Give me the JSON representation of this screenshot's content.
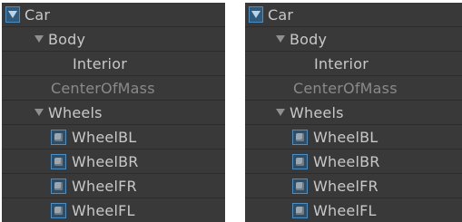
{
  "hierarchy_left": {
    "items": [
      {
        "label": "Car"
      },
      {
        "label": "Body"
      },
      {
        "label": "Interior"
      },
      {
        "label": "CenterOfMass"
      },
      {
        "label": "Wheels"
      },
      {
        "label": "WheelBL"
      },
      {
        "label": "WheelBR"
      },
      {
        "label": "WheelFR"
      },
      {
        "label": "WheelFL"
      }
    ]
  },
  "hierarchy_right": {
    "items": [
      {
        "label": "Car"
      },
      {
        "label": "Body"
      },
      {
        "label": "Interior"
      },
      {
        "label": "CenterOfMass"
      },
      {
        "label": "Wheels"
      },
      {
        "label": "WheelBL"
      },
      {
        "label": "WheelBR"
      },
      {
        "label": "WheelFR"
      },
      {
        "label": "WheelFL"
      }
    ]
  },
  "colors": {
    "panel_bg": "#393939",
    "text": "#c8c8c8",
    "dim_text": "#8a8a8a",
    "selection_blue": "#4a8ec4"
  },
  "icons": [
    "foldout-arrow-icon",
    "prefab-root-icon",
    "mesh-cube-icon"
  ]
}
